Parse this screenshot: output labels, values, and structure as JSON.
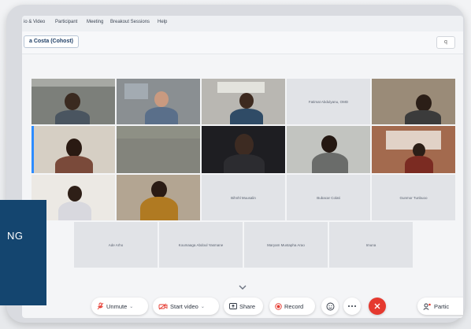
{
  "menu": [
    "io & Video",
    "Participant",
    "Meeting",
    "Breakout Sessions",
    "Help"
  ],
  "meeting_title": "a Costa (Cohost)",
  "search_glyph": "q",
  "tiles": {
    "name_r1c4": "Fatimat Abdulyanu, OMD",
    "name_r3c3": "Bihnhl Muusalin",
    "name_r3c4": "Bubacar Colati",
    "name_r3c5": "Gunmor Tunbuoo",
    "name_r4c1": "Ade Arho",
    "name_r4c2": "Koumaaga Abdoul Yasmane",
    "name_r4c3": "Maryam Mustapha Arao",
    "name_r4c4": "Imuna"
  },
  "toolbar": {
    "unmute": "Unmute",
    "start_video": "Start video",
    "share": "Share",
    "record": "Record",
    "participants": "Partic"
  },
  "banner_text": "NG",
  "colors": {
    "banner": "#14456f",
    "leave_button": "#e5392f",
    "record_dot": "#e5392f",
    "speaker_highlight": "#2d8cff"
  }
}
